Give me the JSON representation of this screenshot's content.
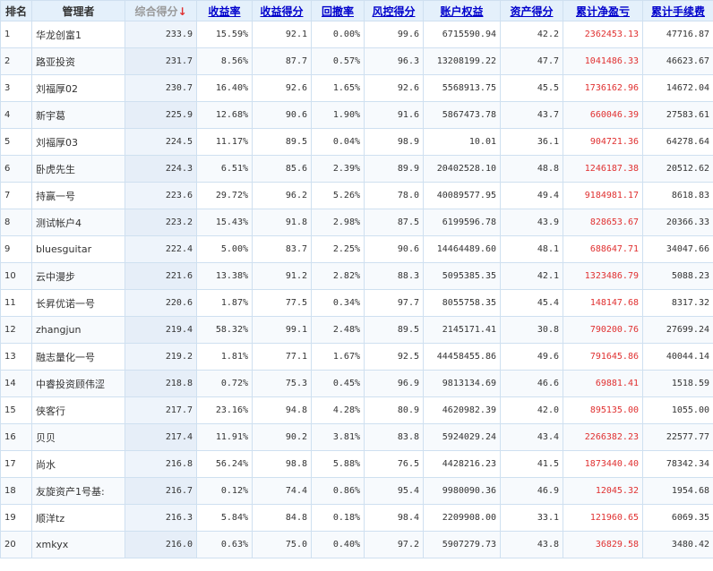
{
  "columns": [
    "排名",
    "管理者",
    "综合得分",
    "收益率",
    "收益得分",
    "回撤率",
    "风控得分",
    "账户权益",
    "资产得分",
    "累计净盈亏",
    "累计手续费"
  ],
  "sort_arrow": "↓",
  "colors": {
    "header_bg": "#e4f0fb",
    "link": "#0000cc",
    "profit": "#e03030",
    "border": "#cfe0f0"
  },
  "rows": [
    [
      "1",
      "华龙创富1",
      "233.9",
      "15.59%",
      "92.1",
      "0.00%",
      "99.6",
      "6715590.94",
      "42.2",
      "2362453.13",
      "47716.87"
    ],
    [
      "2",
      "路亚投资",
      "231.7",
      "8.56%",
      "87.7",
      "0.57%",
      "96.3",
      "13208199.22",
      "47.7",
      "1041486.33",
      "46623.67"
    ],
    [
      "3",
      "刘福厚02",
      "230.7",
      "16.40%",
      "92.6",
      "1.65%",
      "92.6",
      "5568913.75",
      "45.5",
      "1736162.96",
      "14672.04"
    ],
    [
      "4",
      "新宇葛",
      "225.9",
      "12.68%",
      "90.6",
      "1.90%",
      "91.6",
      "5867473.78",
      "43.7",
      "660046.39",
      "27583.61"
    ],
    [
      "5",
      "刘福厚03",
      "224.5",
      "11.17%",
      "89.5",
      "0.04%",
      "98.9",
      "10.01",
      "36.1",
      "904721.36",
      "64278.64"
    ],
    [
      "6",
      "卧虎先生",
      "224.3",
      "6.51%",
      "85.6",
      "2.39%",
      "89.9",
      "20402528.10",
      "48.8",
      "1246187.38",
      "20512.62"
    ],
    [
      "7",
      "持赢一号",
      "223.6",
      "29.72%",
      "96.2",
      "5.26%",
      "78.0",
      "40089577.95",
      "49.4",
      "9184981.17",
      "8618.83"
    ],
    [
      "8",
      "测试帐户4",
      "223.2",
      "15.43%",
      "91.8",
      "2.98%",
      "87.5",
      "6199596.78",
      "43.9",
      "828653.67",
      "20366.33"
    ],
    [
      "9",
      "bluesguitar",
      "222.4",
      "5.00%",
      "83.7",
      "2.25%",
      "90.6",
      "14464489.60",
      "48.1",
      "688647.71",
      "34047.66"
    ],
    [
      "10",
      "云中漫步",
      "221.6",
      "13.38%",
      "91.2",
      "2.82%",
      "88.3",
      "5095385.35",
      "42.1",
      "1323486.79",
      "5088.23"
    ],
    [
      "11",
      "长昇优诺一号",
      "220.6",
      "1.87%",
      "77.5",
      "0.34%",
      "97.7",
      "8055758.35",
      "45.4",
      "148147.68",
      "8317.32"
    ],
    [
      "12",
      "zhangjun",
      "219.4",
      "58.32%",
      "99.1",
      "2.48%",
      "89.5",
      "2145171.41",
      "30.8",
      "790200.76",
      "27699.24"
    ],
    [
      "13",
      "融志量化一号",
      "219.2",
      "1.81%",
      "77.1",
      "1.67%",
      "92.5",
      "44458455.86",
      "49.6",
      "791645.86",
      "40044.14"
    ],
    [
      "14",
      "中睿投资顾伟涩",
      "218.8",
      "0.72%",
      "75.3",
      "0.45%",
      "96.9",
      "9813134.69",
      "46.6",
      "69881.41",
      "1518.59"
    ],
    [
      "15",
      "侠客行",
      "217.7",
      "23.16%",
      "94.8",
      "4.28%",
      "80.9",
      "4620982.39",
      "42.0",
      "895135.00",
      "1055.00"
    ],
    [
      "16",
      "贝贝",
      "217.4",
      "11.91%",
      "90.2",
      "3.81%",
      "83.8",
      "5924029.24",
      "43.4",
      "2266382.23",
      "22577.77"
    ],
    [
      "17",
      "尚水",
      "216.8",
      "56.24%",
      "98.8",
      "5.88%",
      "76.5",
      "4428216.23",
      "41.5",
      "1873440.40",
      "78342.34"
    ],
    [
      "18",
      "友旋资产1号基:",
      "216.7",
      "0.12%",
      "74.4",
      "0.86%",
      "95.4",
      "9980090.36",
      "46.9",
      "12045.32",
      "1954.68"
    ],
    [
      "19",
      "顺洋tz",
      "216.3",
      "5.84%",
      "84.8",
      "0.18%",
      "98.4",
      "2209908.00",
      "33.1",
      "121960.65",
      "6069.35"
    ],
    [
      "20",
      "xmkyx",
      "216.0",
      "0.63%",
      "75.0",
      "0.40%",
      "97.2",
      "5907279.73",
      "43.8",
      "36829.58",
      "3480.42"
    ]
  ]
}
